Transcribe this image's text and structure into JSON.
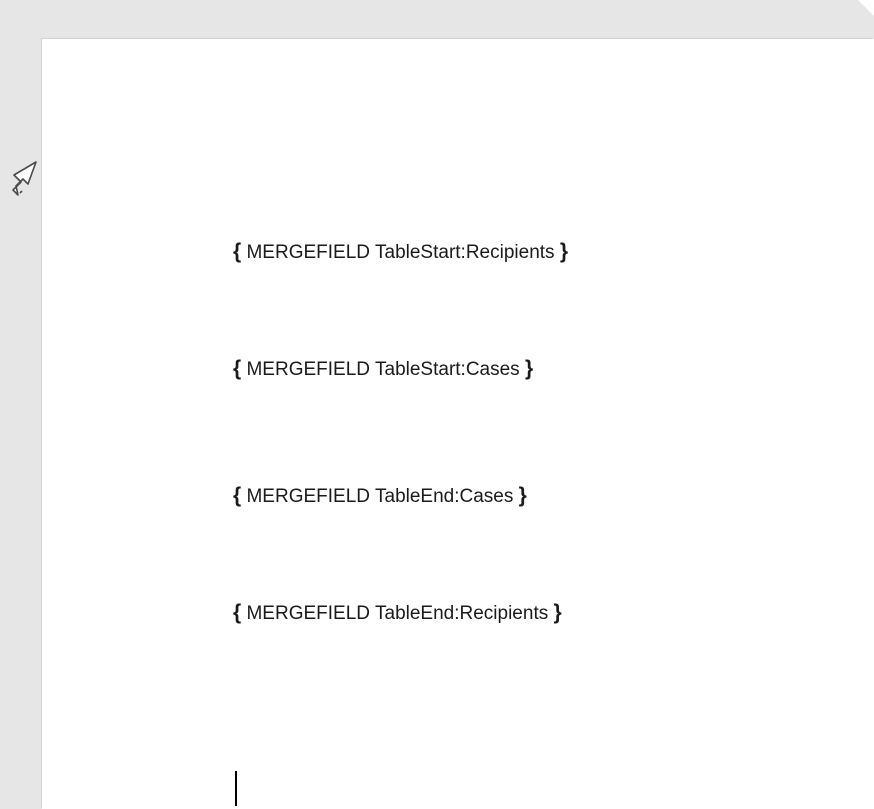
{
  "document": {
    "fields": [
      {
        "open": "{",
        "keyword": "MERGEFIELD",
        "name": "TableStart:Recipients",
        "close": "}"
      },
      {
        "open": "{",
        "keyword": "MERGEFIELD",
        "name": "TableStart:Cases",
        "close": "}"
      },
      {
        "open": "{",
        "keyword": "MERGEFIELD",
        "name": "TableEnd:Cases",
        "close": "}"
      },
      {
        "open": "{",
        "keyword": "MERGEFIELD",
        "name": "TableEnd:Recipients",
        "close": "}"
      }
    ]
  },
  "icons": {
    "row_select_pointer": "row-select-pointer-icon"
  },
  "colors": {
    "background": "#e6e6e6",
    "page": "#ffffff",
    "text": "#1a1a1a"
  }
}
